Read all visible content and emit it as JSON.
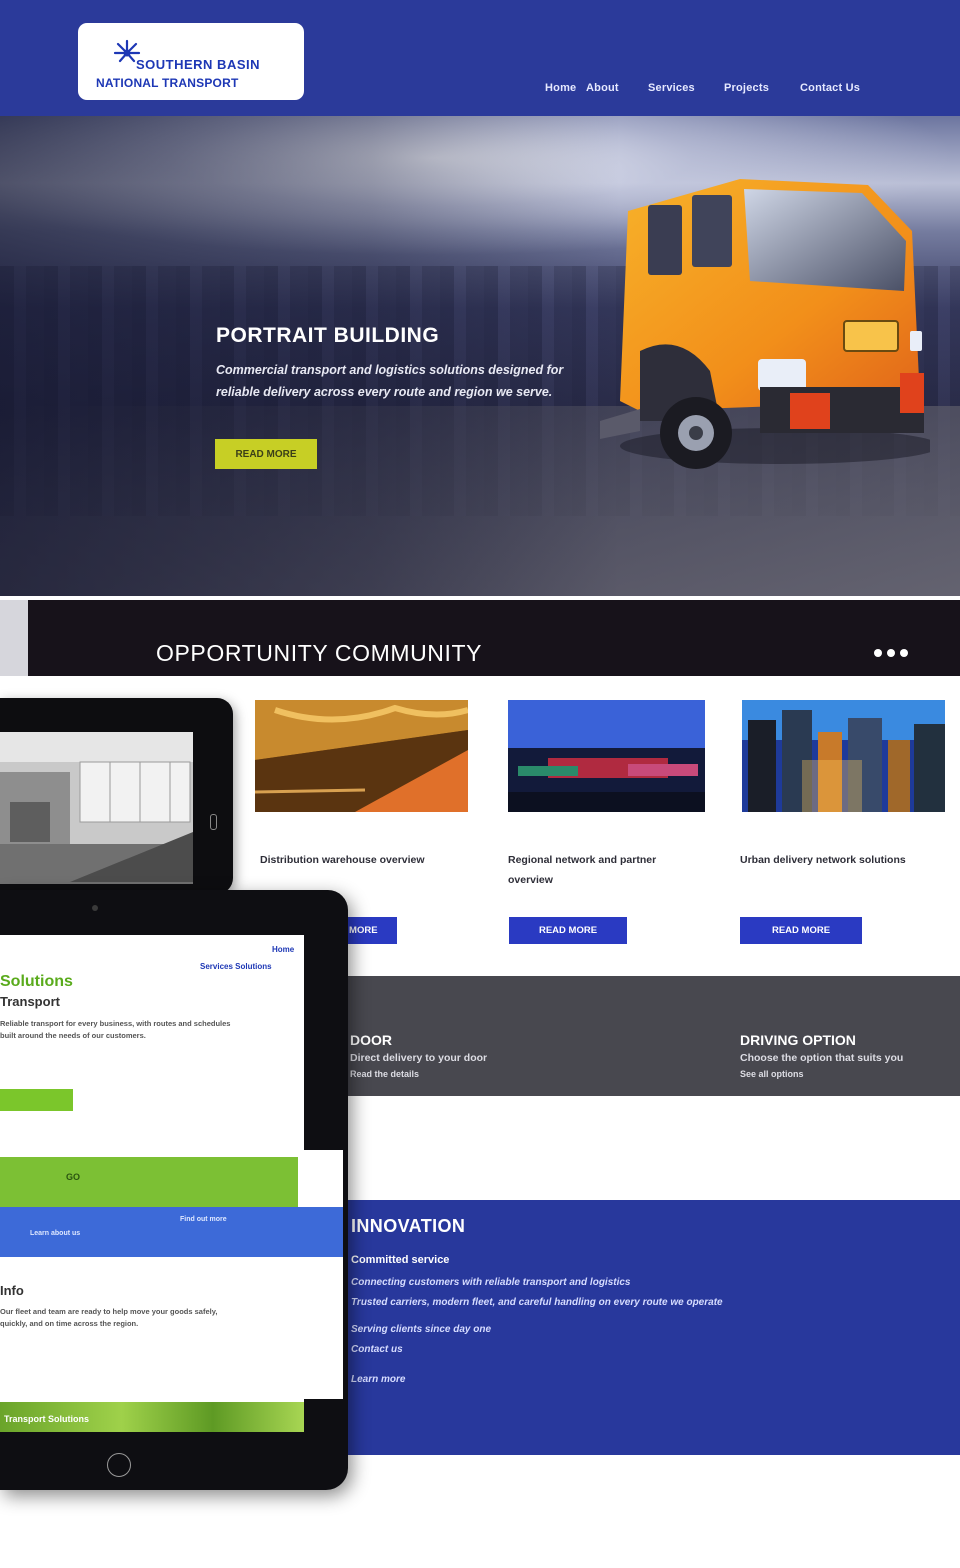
{
  "colors": {
    "header_bg": "#2b3a9a",
    "accent_yellow": "#c7cf25",
    "card_button": "#2a3ac2",
    "dark_band": "#17121a",
    "gray_strip": "#48484f",
    "blue_section": "#28389c",
    "truck_orange": "#f5a21e",
    "tablet_green": "#7cc034"
  },
  "header": {
    "logo_line1": "SOUTHERN BASIN",
    "logo_line2": "NATIONAL TRANSPORT",
    "logo_icon": "sunburst-logo-icon",
    "nav": [
      "Home",
      "About",
      "Services",
      "Projects",
      "Contact Us"
    ]
  },
  "hero": {
    "title": "PORTRAIT BUILDING",
    "text": "Commercial transport and logistics solutions designed for reliable delivery across every route and region we serve.",
    "button_label": "READ MORE"
  },
  "band": {
    "title": "OPPORTUNITY COMMUNITY",
    "dots_icon": "more-dots-icon"
  },
  "cards": [
    {
      "text": "Distribution warehouse overview",
      "button_label": "READ MORE"
    },
    {
      "text": "Regional network and partner overview",
      "button_label": "READ MORE"
    },
    {
      "text": "Urban delivery network solutions",
      "button_label": "READ MORE"
    }
  ],
  "gray": {
    "left_heading": "DOOR",
    "left_text1": "Direct delivery to your door",
    "left_text2": "Read the details",
    "right_heading": "DRIVING OPTION",
    "right_text1": "Choose the option that suits you",
    "right_text2": "See all options"
  },
  "blue": {
    "title": "INNOVATION",
    "subtitle": "Committed service",
    "line1": "Connecting customers with reliable transport and logistics",
    "line2": "Trusted carriers, modern fleet, and careful handling on every route we operate",
    "line3": "Serving clients since day one",
    "line4": "Contact us",
    "line5": "Learn more"
  },
  "tablet": {
    "nav1": "Home",
    "nav2": "Services Solutions",
    "title": "Solutions",
    "subtitle": "Transport",
    "para1": "Reliable transport for every business, with routes and schedules built around the needs of our customers.",
    "green_label": "GO",
    "bluebar_left": "Learn about us",
    "bluebar_right": "Find out more",
    "h2": "Info",
    "para2": "Our fleet and team are ready to help move your goods safely, quickly, and on time across the region.",
    "strip_label": "Transport Solutions"
  }
}
